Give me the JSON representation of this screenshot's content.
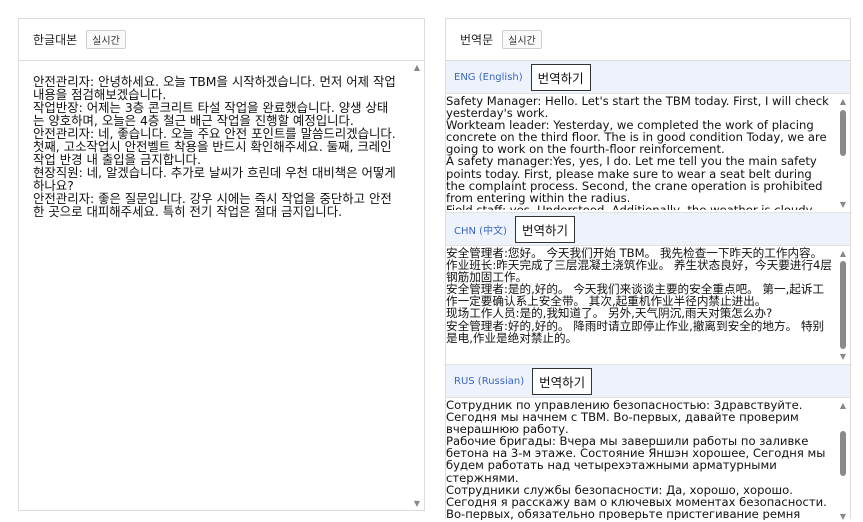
{
  "left": {
    "title": "한글대본",
    "tag": "실시간",
    "text": "안전관리자: 안녕하세요. 오늘 TBM을 시작하겠습니다. 먼저 어제 작업 내용을 점검해보겠습니다.\n작업반장: 어제는 3층 콘크리트 타설 작업을 완료했습니다. 양생 상태는 양호하며, 오늘은 4층 철근 배근 작업을 진행할 예정입니다.\n안전관리자: 네, 좋습니다. 오늘 주요 안전 포인트를 말씀드리겠습니다. 첫째, 고소작업시 안전벨트 착용을 반드시 확인해주세요. 둘째, 크레인 작업 반경 내 출입을 금지합니다.\n현장직원: 네, 알겠습니다. 추가로 날씨가 흐린데 우천 대비책은 어떻게 하나요?\n안전관리자: 좋은 질문입니다. 강우 시에는 즉시 작업을 중단하고 안전한 곳으로 대피해주세요. 특히 전기 작업은 절대 금지입니다."
  },
  "right": {
    "title": "번역문",
    "tag": "실시간",
    "sections": [
      {
        "lang": "ENG (English)",
        "button": "번역하기",
        "text": "Safety Manager: Hello. Let's start the TBM today. First, I will check yesterday's work.\nWorkteam leader: Yesterday, we completed the work of placing concrete on the third floor. The is in good condition Today, we are going to work on the fourth-floor reinforcement.\nA safety manager:Yes, yes, I do. Let me tell you the main safety points today. First, please make sure to wear a seat belt during the complaint process. Second, the crane operation is prohibited from entering within the radius.\nField staff: yes, Understood. Additionally, the weather is cloudy"
      },
      {
        "lang": "CHN (中文)",
        "button": "번역하기",
        "text": "安全管理者:您好。 今天我们开始 TBM。 我先检查一下昨天的工作内容。\n作业班长:昨天完成了三层混凝土浇筑作业。 养生状态良好，今天要进行4层钢筋加固工作。\n安全管理者:是的,好的。 今天我们来谈谈主要的安全重点吧。 第一,起诉工作一定要确认系上安全带。 其次,起重机作业半径内禁止进出。\n现场工作人员:是的,我知道了。 另外,天气阴沉,雨天对策怎么办?\n安全管理者:好的,好的。 降雨时请立即停止作业,撤离到安全的地方。 特别是电,作业是绝对禁止的。"
      },
      {
        "lang": "RUS (Russian)",
        "button": "번역하기",
        "text": "Сотрудник по управлению безопасностью: Здравствуйте. Сегодня мы начнем с TBM. Во-первых, давайте проверим вчерашнюю работу.\nРабочие бригады: Вчера мы завершили работы по заливке бетона на 3-м этаже. Состояние Яншэн хорошее, Сегодня мы будем работать над четырехэтажными арматурными стержнями.\nСотрудники службы безопасности: Да, хорошо, хорошо. Сегодня я расскажу вам о ключевых моментах безопасности. Во-первых, обязательно проверьте пристегивание ремня безопасности при"
      }
    ]
  }
}
